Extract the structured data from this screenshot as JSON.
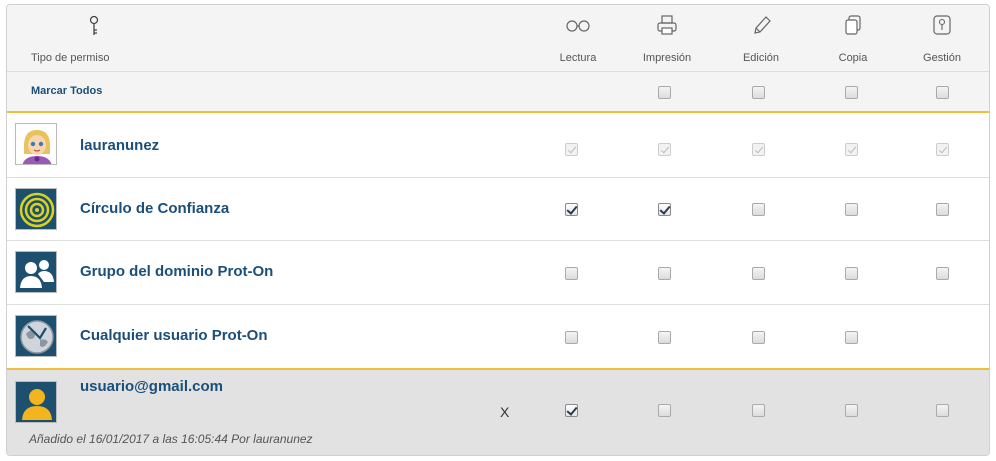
{
  "header": {
    "type_label": "Tipo de permiso",
    "columns": [
      {
        "label": "Lectura",
        "icon": "glasses-icon"
      },
      {
        "label": "Impresión",
        "icon": "printer-icon"
      },
      {
        "label": "Edición",
        "icon": "pencil-icon"
      },
      {
        "label": "Copia",
        "icon": "copy-icon"
      },
      {
        "label": "Gestión",
        "icon": "manage-icon"
      }
    ]
  },
  "mark_all": {
    "label": "Marcar Todos",
    "checks": [
      "off",
      "off",
      "off",
      "off"
    ]
  },
  "rows": [
    {
      "name": "lauranunez",
      "avatar": "user-avatar-icon",
      "checks": [
        "disabled",
        "disabled",
        "disabled",
        "disabled",
        "disabled"
      ]
    },
    {
      "name": "Círculo de Confianza",
      "avatar": "target-circle-icon",
      "checks": [
        "on",
        "on",
        "off",
        "off",
        "off"
      ]
    },
    {
      "name": "Grupo del dominio Prot-On",
      "avatar": "group-icon",
      "checks": [
        "off",
        "off",
        "off",
        "off",
        "off"
      ]
    },
    {
      "name": "Cualquier usuario Prot-On",
      "avatar": "globe-icon",
      "checks": [
        "off",
        "off",
        "off",
        "off",
        "none"
      ]
    },
    {
      "name": "usuario@gmail.com",
      "avatar": "generic-user-icon",
      "checks": [
        "on",
        "off",
        "off",
        "off",
        "off"
      ],
      "remove_label": "X",
      "meta": "Añadido el 16/01/2017 a las 16:05:44 Por lauranunez"
    }
  ],
  "colors": {
    "accent": "#f0bd3c",
    "name": "#1b4f7a",
    "header_bg": "#f4f4f4",
    "shaded_row": "#e2e2e2"
  }
}
